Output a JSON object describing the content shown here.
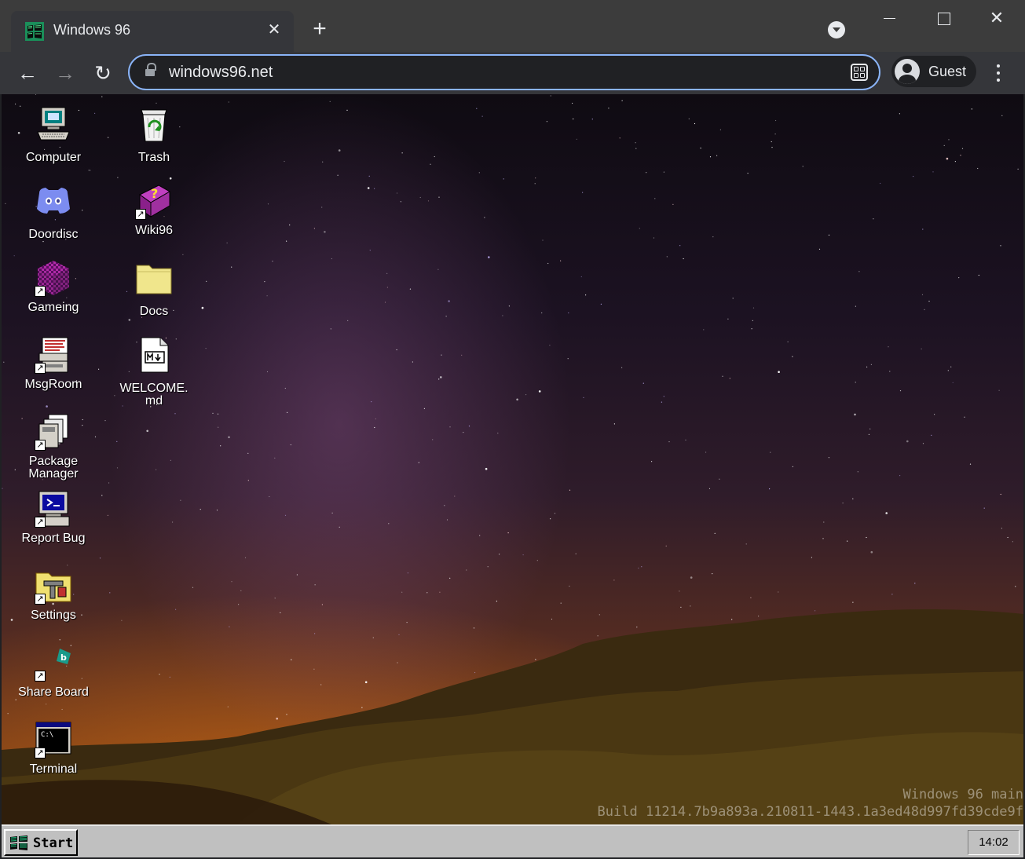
{
  "browser": {
    "tab_title": "Windows 96",
    "tab_close_glyph": "✕",
    "new_tab_glyph": "+",
    "back_glyph": "←",
    "forward_glyph": "→",
    "reload_glyph": "↻",
    "close_glyph": "✕",
    "url": "windows96.net",
    "profile_name": "Guest",
    "colors": {
      "frame": "#3c3c3c",
      "toolbar": "#35363a",
      "omnibox_focus": "#8ab4f8"
    }
  },
  "desktop": {
    "icons": [
      {
        "label": "Computer",
        "icon": "computer-icon"
      },
      {
        "label": "Trash",
        "icon": "recycle-bin-icon"
      },
      {
        "label": "Doordisc",
        "icon": "doordisc-icon"
      },
      {
        "label": "Wiki96",
        "icon": "help-book-icon"
      },
      {
        "label": "Gameing",
        "icon": "game-cube-icon"
      },
      {
        "label": "Docs",
        "icon": "folder-icon"
      },
      {
        "label": "MsgRoom",
        "icon": "msgroom-icon"
      },
      {
        "label": "WELCOME.md",
        "icon": "markdown-file-icon"
      },
      {
        "label": "Package Manager",
        "icon": "package-manager-icon"
      },
      {
        "label": "Report Bug",
        "icon": "report-bug-icon"
      },
      {
        "label": "Settings",
        "icon": "settings-icon"
      },
      {
        "label": "Share Board",
        "icon": "share-board-icon"
      },
      {
        "label": "Terminal",
        "icon": "terminal-icon"
      }
    ],
    "watermark": {
      "line1": "Windows 96 main",
      "line2": "Build 11214.7b9a893a.210811-1443.1a3ed48d997fd39cde9f"
    }
  },
  "taskbar": {
    "start_label": "Start",
    "clock": "14:02"
  }
}
